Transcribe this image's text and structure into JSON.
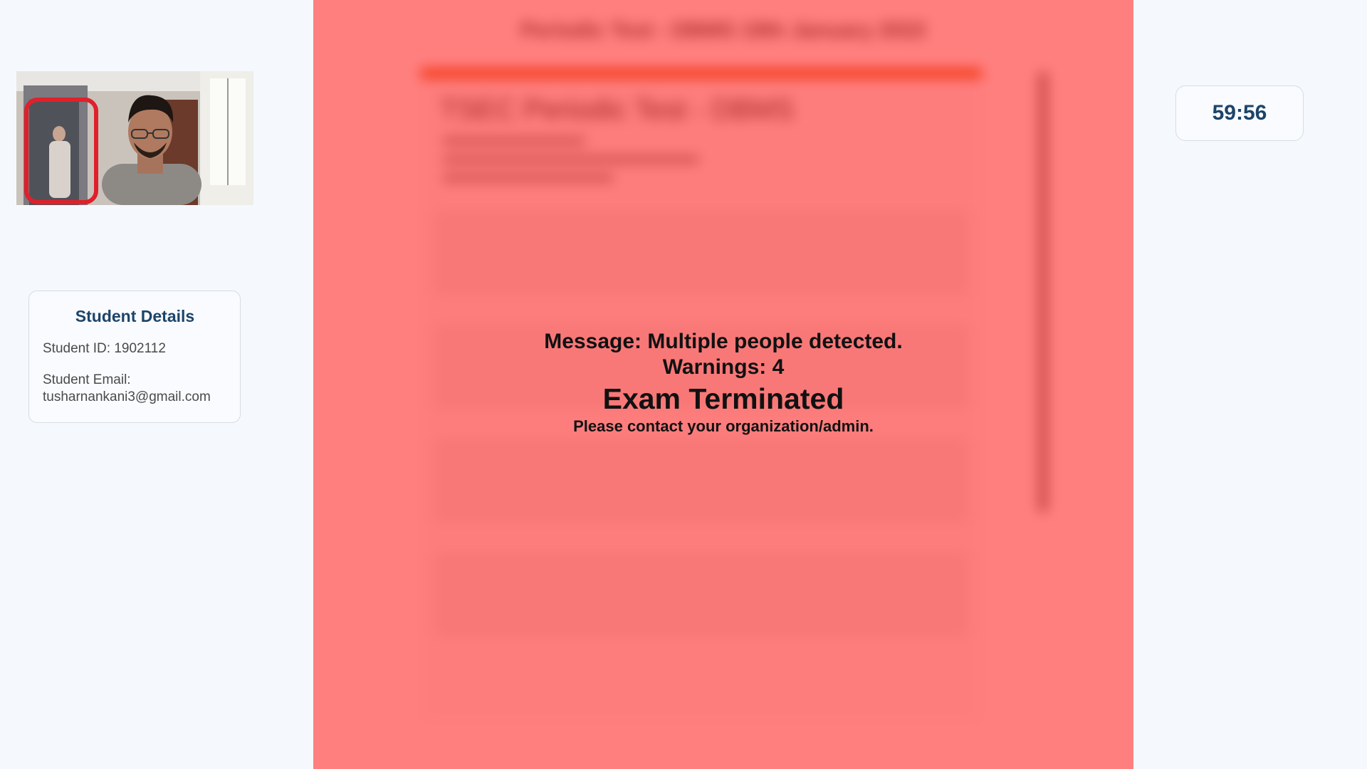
{
  "webcam": {
    "feed_label": "webcam-feed",
    "detection_box_color": "#e0202a"
  },
  "student_details": {
    "title": "Student Details",
    "student_id": "Student ID: 1902112",
    "email_label": "Student Email:",
    "email_value": "tusharnankani3@gmail.com"
  },
  "exam_form": {
    "header": "Periodic Test - DBMS 19th January 2022",
    "title": "TSEC Periodic Test - DBMS",
    "accent_color": "#e7712b"
  },
  "termination": {
    "message": "Message: Multiple people detected.",
    "warnings": "Warnings: 4",
    "status": "Exam Terminated",
    "contact": "Please contact your organization/admin.",
    "overlay_color": "#ff0000"
  },
  "timer": {
    "value": "59:56"
  }
}
